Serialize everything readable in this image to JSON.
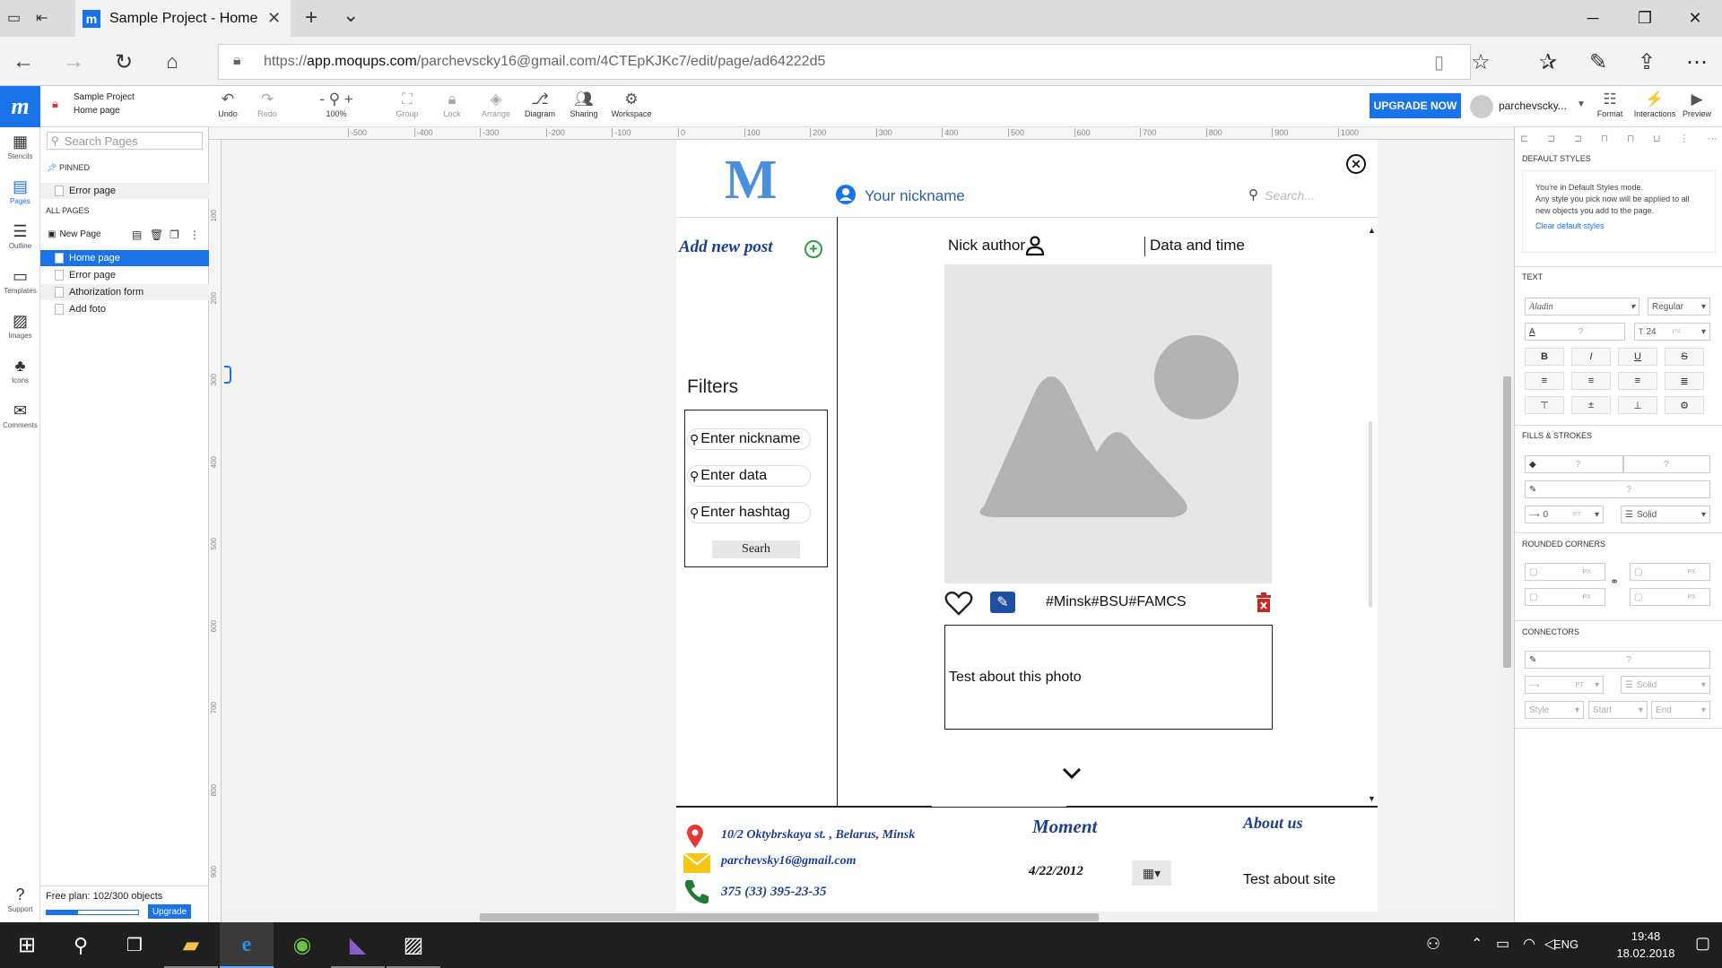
{
  "browser": {
    "tab_title": "Sample Project - Home",
    "favicon_letter": "m",
    "url_prefix": "https://",
    "url_host": "app.moqups.com",
    "url_path": "/parchevscky16@gmail.com/4CTEpKJKc7/edit/page/ad64222d5",
    "new_tab": "+",
    "tab_dropdown": "⌄"
  },
  "app": {
    "logo": "m",
    "project_name": "Sample Project",
    "page_name": "Home page",
    "toolbar": {
      "undo": "Undo",
      "redo": "Redo",
      "zoom": "100%",
      "group": "Group",
      "lock": "Lock",
      "arrange": "Arrange",
      "diagram": "Diagram",
      "sharing": "Sharing",
      "workspace": "Workspace",
      "upgrade_now": "UPGRADE NOW",
      "user": "parchevscky...",
      "format": "Format",
      "interactions": "Interactions",
      "preview": "Preview"
    },
    "rail": [
      "Stencils",
      "Pages",
      "Outline",
      "Templates",
      "Images",
      "Icons",
      "Comments"
    ],
    "support": "Support"
  },
  "pages_panel": {
    "search_placeholder": "Search Pages",
    "pinned_label": "PINNED",
    "pinned": [
      "Error page"
    ],
    "all_pages_label": "ALL PAGES",
    "new_page": "New Page",
    "pages": [
      "Home page",
      "Error page",
      "Athorization form",
      "Add foto"
    ],
    "plan": "Free plan: 102/300 objects",
    "plan_used_fraction": 0.34,
    "upgrade": "Upgrade"
  },
  "rulers": {
    "top": [
      "-500",
      "-400",
      "-300",
      "-200",
      "-100",
      "0",
      "100",
      "200",
      "300",
      "400",
      "500",
      "600",
      "700",
      "800",
      "900",
      "1000"
    ],
    "left": [
      "100",
      "200",
      "300",
      "400",
      "500",
      "600",
      "700",
      "800",
      "900"
    ]
  },
  "mockup": {
    "logo": "M",
    "nickname": "Your nickname",
    "search_placeholder": "Search...",
    "add_post": "Add new post",
    "filters_title": "Filters",
    "filter_fields": [
      "Enter nickname",
      "Enter data",
      "Enter hashtag"
    ],
    "search_button": "Searh",
    "nick_author": "Nick author",
    "date_time": "Data and time",
    "hashtags": "#Minsk#BSU#FAMCS",
    "photo_text": "Test about this photo",
    "footer": {
      "address": "10/2 Oktybrskaya st. , Belarus, Minsk",
      "email": "parchevsky16@gmail.com",
      "phone": "375 (33) 395-23-35",
      "moment_title": "Moment",
      "date": "4/22/2012",
      "about_title": "About us",
      "about_text": "Test about site"
    }
  },
  "right_panel": {
    "default_styles": "DEFAULT STYLES",
    "notice_title": "You're in Default Styles mode.",
    "notice_body": "Any style you pick now will be applied to all new objects you add to the page.",
    "clear_link": "Clear default styles",
    "text_section": "TEXT",
    "font": "Aladin",
    "weight": "Regular",
    "font_size": "24",
    "px": "PX",
    "unknown": "?",
    "fills_section": "FILLS & STROKES",
    "stroke_width": "0",
    "pt": "PT",
    "stroke_style": "Solid",
    "rounded_section": "ROUNDED CORNERS",
    "connectors_section": "CONNECTORS",
    "conn_style": "Style",
    "conn_start": "Start",
    "conn_end": "End"
  },
  "taskbar": {
    "lang": "ENG",
    "time": "19:48",
    "date": "18.02.2018"
  },
  "colors": {
    "accent": "#1a73e8",
    "heading_blue": "#1c3f94",
    "delete_red": "#c62828",
    "add_green": "#2e9e44"
  }
}
